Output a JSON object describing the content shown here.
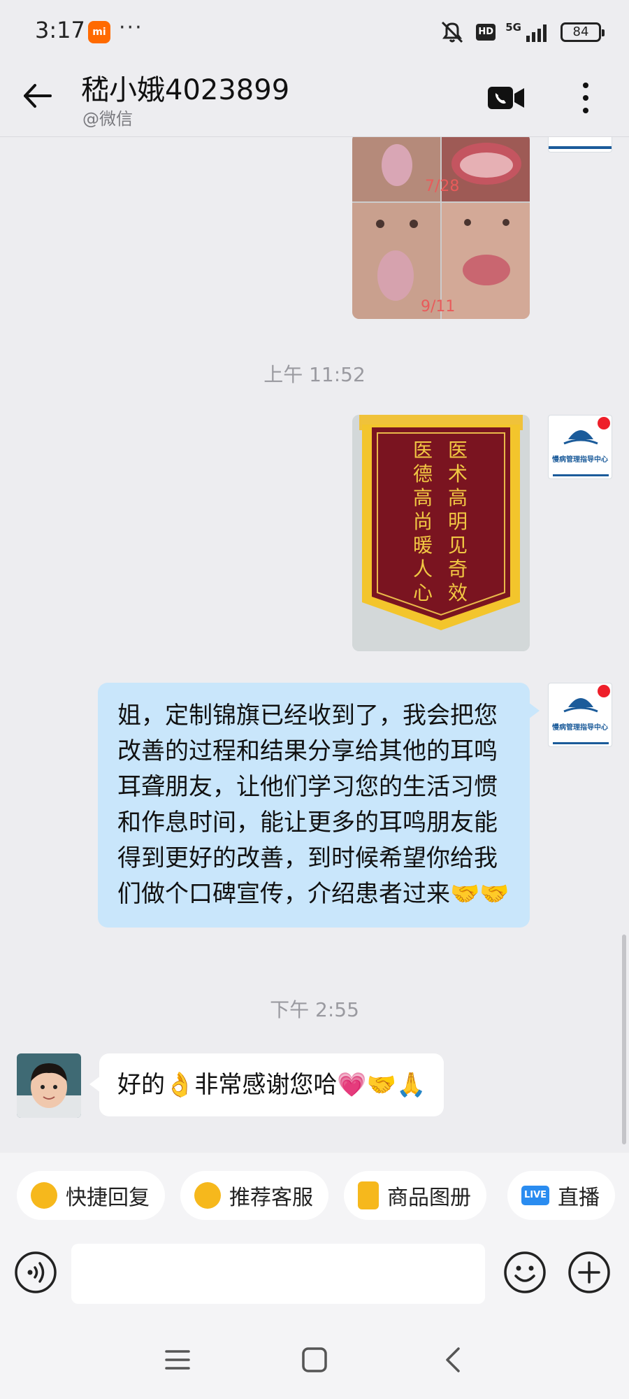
{
  "status_bar": {
    "time": "3:17",
    "brand_badge": "mi",
    "more_dots": "···",
    "hd_label": "HD",
    "network_label": "5G",
    "battery": "84"
  },
  "header": {
    "title": "嵇小娥4023899",
    "subtitle": "@微信"
  },
  "messages": {
    "image1_label_top": "7/28",
    "image1_label_bottom": "9/11",
    "timestamp1": "上午 11:52",
    "banner": {
      "line1": "医术高明见奇效",
      "line2": "医德高尚暖人心"
    },
    "timestamp2": "下午 2:55",
    "outgoing_text": "姐，定制锦旗已经收到了，我会把您改善的过程和结果分享给其他的耳鸣耳聋朋友，让他们学习您的生活习惯和作息时间，能让更多的耳鸣朋友能得到更好的改善，到时候希望你给我们做个口碑宣传，介绍患者过来🤝🤝",
    "incoming_text": "好的👌非常感谢您哈💗🤝🙏",
    "agent_avatar_text": "慢病管理指导中心"
  },
  "quick_replies": [
    {
      "label": "快捷回复",
      "icon": "quick-reply-icon"
    },
    {
      "label": "推荐客服",
      "icon": "service-icon"
    },
    {
      "label": "商品图册",
      "icon": "catalog-icon"
    },
    {
      "label": "直播",
      "icon": "live-icon",
      "badge": "LIVE"
    }
  ],
  "input": {
    "placeholder": ""
  },
  "colors": {
    "background": "#ededf0",
    "outgoing_bubble": "#c9e6fb",
    "incoming_bubble": "#ffffff",
    "accent_yellow": "#f6b81c",
    "live_blue": "#2a8cf0"
  }
}
